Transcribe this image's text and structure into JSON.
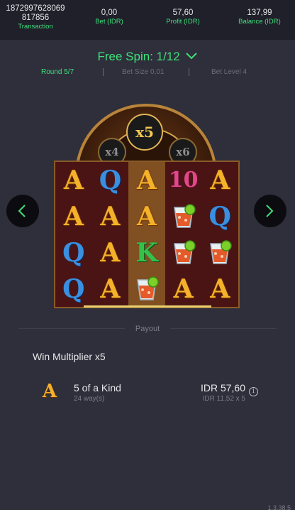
{
  "header": {
    "transaction": {
      "value_line1": "1872997628069",
      "value_line2": "817856",
      "label": "Transaction"
    },
    "bet": {
      "value": "0,00",
      "label": "Bet (IDR)"
    },
    "profit": {
      "value": "57,60",
      "label": "Profit (IDR)"
    },
    "balance": {
      "value": "137,99",
      "label": "Balance (IDR)"
    }
  },
  "free_spin": {
    "title": "Free Spin: 1/12"
  },
  "round_info": {
    "round": "Round 5/7",
    "bet_size": "Bet Size 0,01",
    "bet_level": "Bet Level 4"
  },
  "multipliers": {
    "current": "x5",
    "left": "x4",
    "right": "x6"
  },
  "reels": {
    "rows": [
      [
        "A",
        "Q",
        "A",
        "10",
        "A"
      ],
      [
        "A",
        "A",
        "A",
        "cocktail",
        "Q"
      ],
      [
        "Q",
        "A",
        "K",
        "cocktail",
        "cocktail"
      ],
      [
        "Q",
        "A",
        "cocktail",
        "A",
        "A"
      ]
    ],
    "highlighted_column": 2
  },
  "payout": {
    "label": "Payout",
    "win_multiplier": "Win Multiplier x5",
    "symbol": "A",
    "kind": "5 of a Kind",
    "ways": "24 way(s)",
    "amount": "IDR 57,60",
    "calc": "IDR 11,52 x 5"
  },
  "version": "1.3.38.5",
  "colors": {
    "accent": "#3ee07a",
    "background": "#2f2f3b",
    "header_bg": "#20202a"
  }
}
